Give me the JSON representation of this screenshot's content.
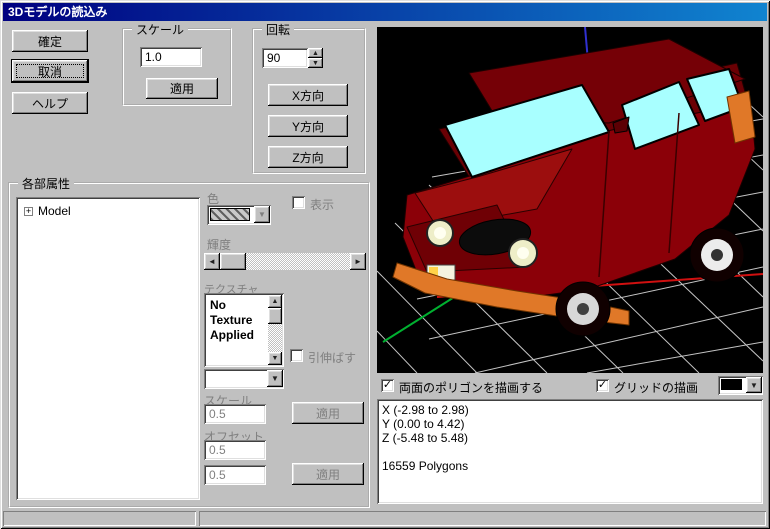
{
  "window": {
    "title": "3Dモデルの読込み"
  },
  "actions": {
    "confirm": "確定",
    "cancel": "取消",
    "help": "ヘルプ"
  },
  "scale_group": {
    "title": "スケール",
    "value": "1.0",
    "apply": "適用"
  },
  "rotate_group": {
    "title": "回転",
    "value": "90",
    "x_dir": "X方向",
    "y_dir": "Y方向",
    "z_dir": "Z方向"
  },
  "attr_group": {
    "title": "各部属性",
    "tree_root": "Model",
    "color_label": "色",
    "show_label": "表示",
    "brightness_label": "輝度",
    "texture_label": "テクスチャ",
    "texture_line1": "No",
    "texture_line2": "Texture",
    "texture_line3": "Applied",
    "stretch_label": "引伸ばす",
    "scale_label": "スケール",
    "scale_value": "0.5",
    "scale_apply": "適用",
    "offset_label": "オフセット",
    "offset_value1": "0.5",
    "offset_value2": "0.5",
    "offset_apply": "適用"
  },
  "viewport": {
    "both_faces_label": "両面のポリゴンを描画する",
    "grid_label": "グリッドの描画",
    "info_x": "X (-2.98 to 2.98)",
    "info_y": "Y (0.00 to 4.42)",
    "info_z": "Z (-5.48 to 5.48)",
    "info_polygons": "16559 Polygons"
  },
  "icons": {
    "dropdown": "▼",
    "spin_up": "▲",
    "spin_down": "▼",
    "scroll_left": "◄",
    "scroll_right": "►",
    "scroll_up": "▲",
    "scroll_down": "▼",
    "check": "✓",
    "tree_expand": "+"
  },
  "colors": {
    "titlebar_start": "#000080",
    "titlebar_end": "#1084d0",
    "car_body": "#8b0008",
    "window_glass": "#a8ffff",
    "bumper": "#e07828",
    "grid_color_swatch": "#000000"
  }
}
